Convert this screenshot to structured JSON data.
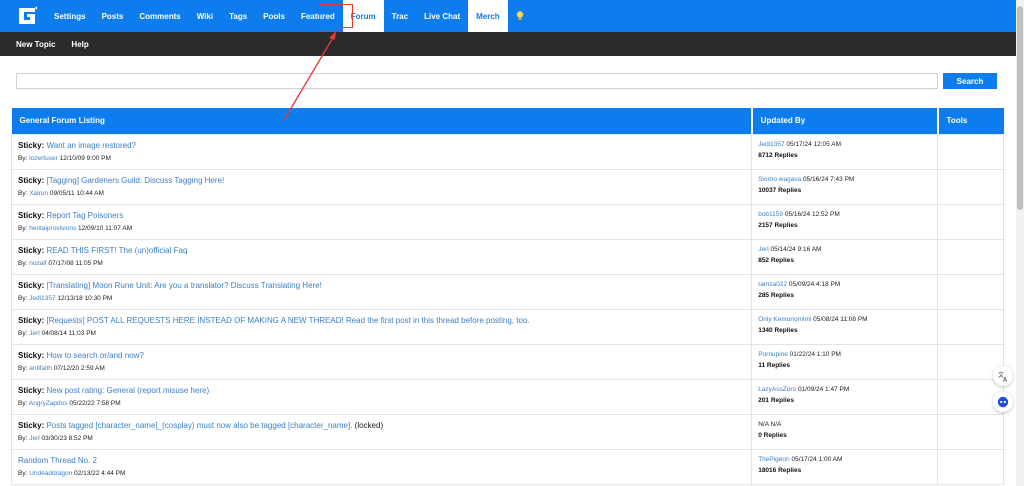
{
  "nav": {
    "logo_icon": "g-logo-icon",
    "items": [
      {
        "label": "Settings"
      },
      {
        "label": "Posts"
      },
      {
        "label": "Comments"
      },
      {
        "label": "Wiki"
      },
      {
        "label": "Tags"
      },
      {
        "label": "Pools"
      },
      {
        "label": "Featured"
      },
      {
        "label": "Forum"
      },
      {
        "label": "Trac"
      },
      {
        "label": "Live Chat"
      },
      {
        "label": "Merch"
      }
    ],
    "bulb_icon": "lightbulb-icon"
  },
  "subnav": {
    "new_topic": "New Topic",
    "help": "Help"
  },
  "search": {
    "placeholder": "",
    "button_label": "Search"
  },
  "table": {
    "headers": {
      "topic": "General Forum Listing",
      "updated": "Updated By",
      "tools": "Tools"
    },
    "rows": [
      {
        "sticky": "Sticky:",
        "title": "Want an image restored?",
        "by_label": "By:",
        "author": "lozertuser",
        "date": "12/10/09 9:00 PM",
        "upd_user": "Jedi1357",
        "upd_date": "05/17/24 12:05 AM",
        "replies": "8712 Replies"
      },
      {
        "sticky": "Sticky:",
        "title": "[Tagging] Gardeners Guild: Discuss Tagging Here!",
        "by_label": "By:",
        "author": "Xalrun",
        "date": "09/05/11 10:44 AM",
        "upd_user": "Siorno wagava",
        "upd_date": "05/16/24 7:43 PM",
        "replies": "10037 Replies"
      },
      {
        "sticky": "Sticky:",
        "title": "Report Tag Poisoners",
        "by_label": "By:",
        "author": "hentaiprovisions",
        "date": "12/09/10 11:07 AM",
        "upd_user": "bob1159",
        "upd_date": "05/16/24 12:52 PM",
        "replies": "2157 Replies"
      },
      {
        "sticky": "Sticky:",
        "title": "READ THIS FIRST! The (un)official Faq",
        "by_label": "By:",
        "author": "nozalf",
        "date": "07/17/08 11:05 PM",
        "upd_user": "Jerl",
        "upd_date": "05/14/24 9:16 AM",
        "replies": "852 Replies"
      },
      {
        "sticky": "Sticky:",
        "title": "[Translating] Moon Rune Unit: Are you a translator? Discuss Translating Here!",
        "by_label": "By:",
        "author": "Jedi1357",
        "date": "12/13/18 10:30 PM",
        "upd_user": "ramza022",
        "upd_date": "05/09/24 4:18 PM",
        "replies": "285 Replies"
      },
      {
        "sticky": "Sticky:",
        "title": "[Requests] POST ALL REQUESTS HERE INSTEAD OF MAKING A NEW THREAD! Read the first post in this thread before posting, too.",
        "by_label": "By:",
        "author": "Jerl",
        "date": "04/08/14 11:03 PM",
        "upd_user": "Only Kemonomimi",
        "upd_date": "05/08/24 11:08 PM",
        "replies": "1340 Replies"
      },
      {
        "sticky": "Sticky:",
        "title": "How to search or/and now?",
        "by_label": "By:",
        "author": "antifaith",
        "date": "07/12/20 2:59 AM",
        "upd_user": "Pornupine",
        "upd_date": "01/22/24 1:10 PM",
        "replies": "11 Replies"
      },
      {
        "sticky": "Sticky:",
        "title": "New post rating: General (report misuse here)",
        "by_label": "By:",
        "author": "AngryZapdos",
        "date": "05/22/22 7:58 PM",
        "upd_user": "LazyAssZoro",
        "upd_date": "01/09/24 1:47 PM",
        "replies": "201 Replies"
      },
      {
        "sticky": "Sticky:",
        "title": "Posts tagged [character_name]_(cosplay) must now also be tagged [character_name].",
        "locked": "(locked)",
        "by_label": "By:",
        "author": "Jerl",
        "date": "03/30/23 8:52 PM",
        "upd_user": "N/A",
        "upd_date": "N/A",
        "replies": "0 Replies"
      },
      {
        "sticky": "",
        "title": "Random Thread No. 2",
        "by_label": "By:",
        "author": "Undeaddragon",
        "date": "02/13/22 4:44 PM",
        "upd_user": "ThePigeon",
        "upd_date": "05/17/24 1:00 AM",
        "replies": "18016 Replies"
      }
    ]
  },
  "floating": {
    "translate_icon": "translate-icon",
    "chat_icon": "chat-bot-icon"
  },
  "colors": {
    "nav_blue": "#0d7dee",
    "subnav_dark": "#2b2b2b",
    "link_blue": "#3d7fc4",
    "annotation_red": "#e53935"
  }
}
